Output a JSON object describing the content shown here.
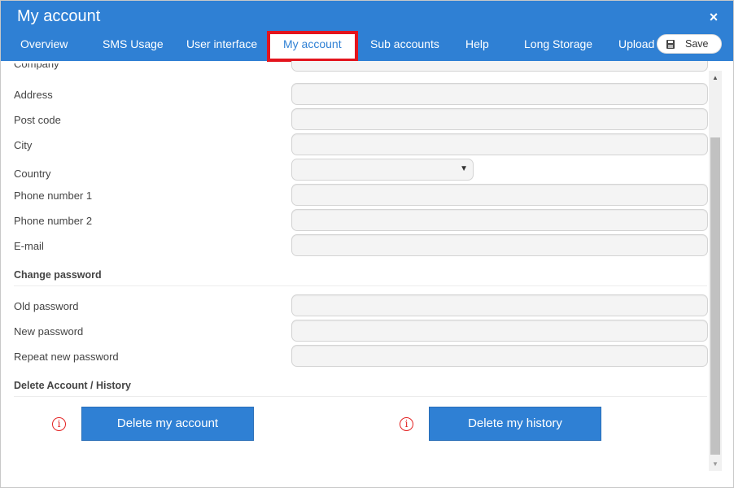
{
  "window": {
    "title": "My account",
    "close_symbol": "×"
  },
  "tabs": [
    {
      "label": "Overview"
    },
    {
      "label": "SMS Usage"
    },
    {
      "label": "User interface"
    },
    {
      "label": "My account",
      "active": true
    },
    {
      "label": "Sub accounts"
    },
    {
      "label": "Help"
    },
    {
      "label": "Long Storage"
    },
    {
      "label": "Upload"
    }
  ],
  "toolbar": {
    "save_label": "Save",
    "save_icon": "floppy-disk-icon"
  },
  "form": {
    "fields": [
      {
        "label": "Company",
        "value": ""
      },
      {
        "label": "Address",
        "value": ""
      },
      {
        "label": "Post code",
        "value": ""
      },
      {
        "label": "City",
        "value": ""
      },
      {
        "label": "Country",
        "value": "",
        "type": "select"
      },
      {
        "label": "Phone number 1",
        "value": ""
      },
      {
        "label": "Phone number 2",
        "value": ""
      },
      {
        "label": "E-mail",
        "value": ""
      }
    ],
    "select_arrow": "▼"
  },
  "password_section": {
    "title": "Change password",
    "fields": [
      {
        "label": "Old password",
        "value": ""
      },
      {
        "label": "New password",
        "value": ""
      },
      {
        "label": "Repeat new password",
        "value": ""
      }
    ]
  },
  "delete_section": {
    "title": "Delete Account / History",
    "info_symbol": "i",
    "delete_account_label": "Delete my account",
    "delete_history_label": "Delete my history"
  },
  "scrollbar": {
    "up": "▲",
    "down": "▼"
  },
  "colors": {
    "header": "#2f80d4",
    "active_tab_highlight": "#e3141d",
    "button": "#2f80d4",
    "info_icon": "#e32222"
  }
}
